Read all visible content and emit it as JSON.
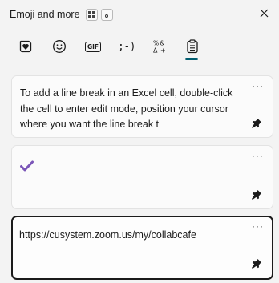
{
  "header": {
    "title": "Emoji and more"
  },
  "tabs": [
    {
      "name": "favorites",
      "icon": "heart-sticker-icon"
    },
    {
      "name": "emoji",
      "icon": "smiley-icon"
    },
    {
      "name": "gif",
      "icon": "gif-icon",
      "label": "GIF"
    },
    {
      "name": "kaomoji",
      "icon": "kaomoji-icon",
      "label": ";-)"
    },
    {
      "name": "symbols",
      "icon": "symbols-icon"
    },
    {
      "name": "clipboard",
      "icon": "clipboard-icon",
      "selected": true
    }
  ],
  "clipboard": {
    "items": [
      {
        "text": "To add a line break in an Excel cell, double-click the cell to enter edit mode, position your cursor where you want the line break t",
        "pinned": true
      },
      {
        "text": "",
        "glyph": "heavy-check-mark",
        "pinned": true
      },
      {
        "text": "https://cusystem.zoom.us/my/collabcafe",
        "pinned": true,
        "focused": true
      }
    ],
    "more_label": "···"
  },
  "colors": {
    "accent": "#005c6f",
    "check": "#7b56b8",
    "background": "#f3f3f3"
  }
}
